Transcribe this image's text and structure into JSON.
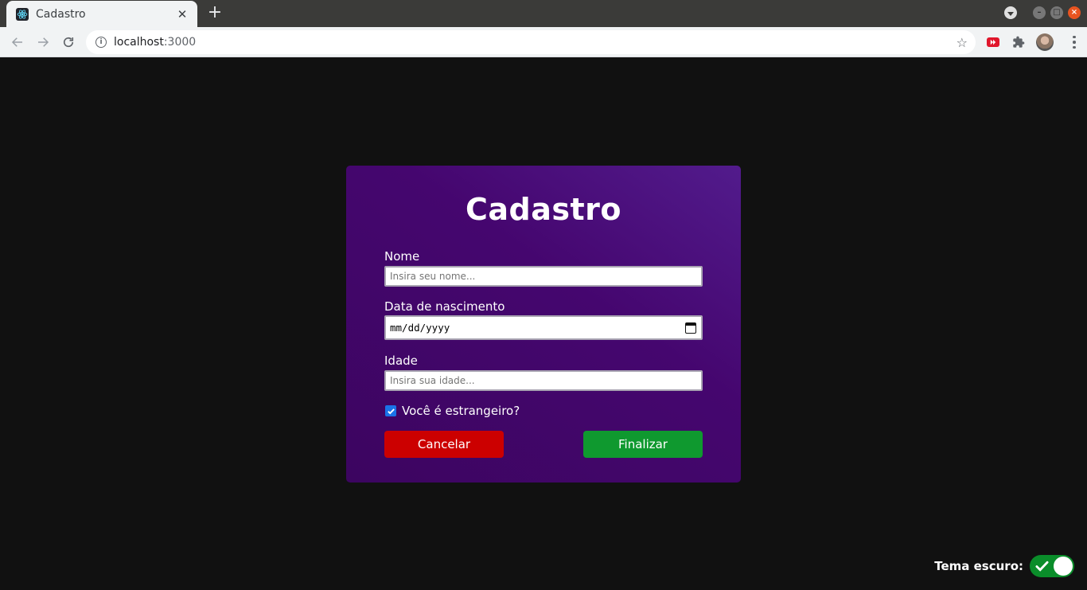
{
  "browser": {
    "tab_title": "Cadastro",
    "tab_close": "✕",
    "new_tab": "+",
    "url_host": "localhost",
    "url_port": ":3000"
  },
  "form": {
    "title": "Cadastro",
    "nome_label": "Nome",
    "nome_placeholder": "Insira seu nome...",
    "data_label": "Data de nascimento",
    "data_value": "mm/dd/yyyy",
    "idade_label": "Idade",
    "idade_placeholder": "Insira sua idade...",
    "estrangeiro_label": "Você é estrangeiro?",
    "estrangeiro_checked": true,
    "cancel_label": "Cancelar",
    "finish_label": "Finalizar"
  },
  "theme": {
    "label": "Tema escuro:",
    "enabled": true
  },
  "colors": {
    "page_bg": "#111111",
    "card_bg": "#45066f",
    "cancel": "#cc0000",
    "finish": "#0f992f",
    "toggle_on": "#0a8d2a"
  }
}
